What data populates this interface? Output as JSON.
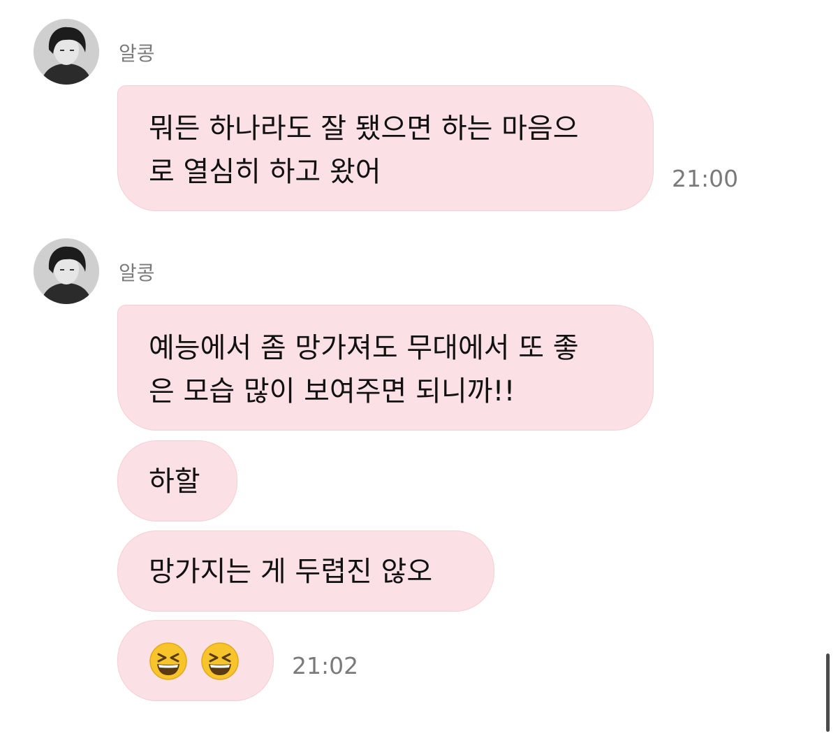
{
  "messages": [
    {
      "sender": "알콩",
      "bubbles": [
        {
          "lines": [
            "뭐든 하나라도 잘 됐으면 하는 마음으",
            "로 열심히 하고 왔어"
          ]
        }
      ],
      "time": "21:00"
    },
    {
      "sender": "알콩",
      "bubbles": [
        {
          "lines": [
            "예능에서 좀 망가져도 무대에서 또 좋",
            "은 모습 많이 보여주면 되니까!!"
          ]
        },
        {
          "lines": [
            "하할"
          ]
        },
        {
          "lines": [
            "망가지는 게 두렵진 않오"
          ]
        },
        {
          "emoji": [
            "grinning-squinting-face-icon",
            "grinning-squinting-face-icon"
          ]
        }
      ],
      "time": "21:02"
    }
  ],
  "colors": {
    "bubble_bg": "#fbe1e5",
    "bubble_border": "#f5cfd5",
    "meta_text": "#7a7a7a"
  }
}
